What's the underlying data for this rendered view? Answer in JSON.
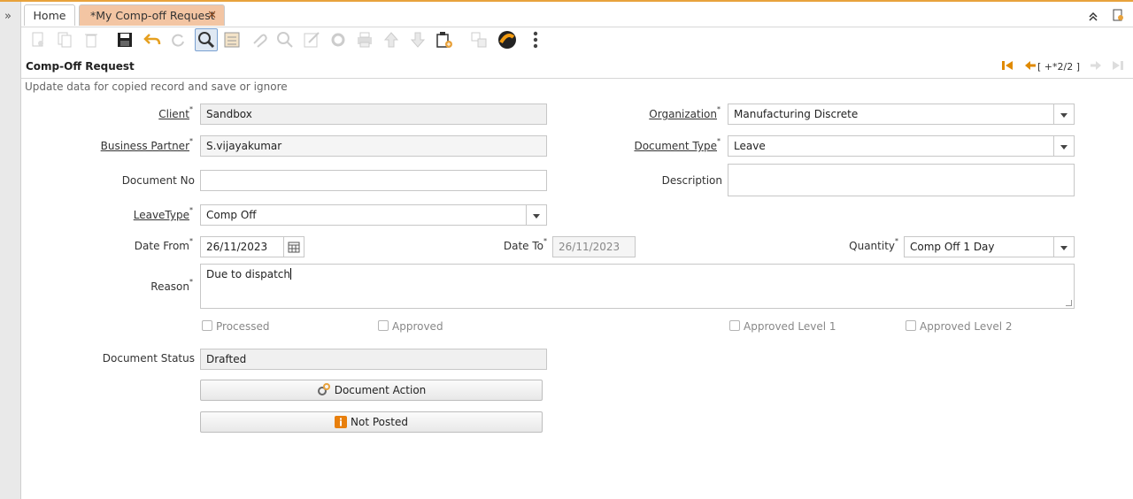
{
  "tabs": {
    "home": "Home",
    "active": "*My Comp-off Request",
    "close": "✕"
  },
  "window": {
    "title": "Comp-Off Request",
    "record": "[ +*2/2 ]",
    "status_message": "Update data for copied record and save or ignore"
  },
  "labels": {
    "client": "Client",
    "org": "Organization",
    "bp": "Business Partner",
    "doctype": "Document Type",
    "docno": "Document No",
    "description": "Description",
    "leavetype": "LeaveType",
    "datefrom": "Date From",
    "dateto": "Date To",
    "quantity": "Quantity",
    "reason": "Reason",
    "docstatus": "Document Status",
    "mandatory": "*"
  },
  "values": {
    "client": "Sandbox",
    "org": "Manufacturing Discrete",
    "bp": "S.vijayakumar",
    "doctype": "Leave",
    "docno": "",
    "description": "",
    "leavetype": "Comp Off",
    "datefrom": "26/11/2023",
    "dateto": "26/11/2023",
    "quantity": "Comp Off 1 Day",
    "reason": "Due to dispatch",
    "docstatus": "Drafted"
  },
  "checkboxes": {
    "processed": "Processed",
    "approved": "Approved",
    "approved1": "Approved Level 1",
    "approved2": "Approved Level 2"
  },
  "buttons": {
    "docaction": "Document Action",
    "posted": "Not Posted"
  },
  "colors": {
    "accent": "#e8a23c",
    "active_tab": "#f3c5a3"
  }
}
